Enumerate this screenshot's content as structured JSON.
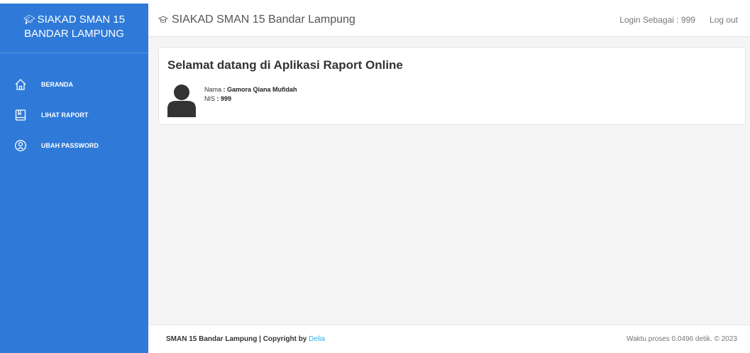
{
  "sidebar": {
    "brand_line1": "SIAKAD SMAN 15",
    "brand_line2": "BANDAR LAMPUNG",
    "items": [
      {
        "label": "BERANDA",
        "icon": "home-icon"
      },
      {
        "label": "LIHAT RAPORT",
        "icon": "book-icon"
      },
      {
        "label": "UBAH PASSWORD",
        "icon": "user-circle-icon"
      }
    ]
  },
  "header": {
    "title": "SIAKAD SMAN 15 Bandar Lampung",
    "login_info": "Login Sebagai : 999",
    "logout_label": "Log out"
  },
  "main": {
    "welcome": "Selamat datang di Aplikasi Raport Online",
    "nama_label": "Nama",
    "nama_value": ": Gamora Qiana Mufidah",
    "nis_label": "NIS",
    "nis_value": ": 999"
  },
  "footer": {
    "left_text": "SMAN 15 Bandar Lampung | Copyright by ",
    "author": "Delia",
    "right_text": "Waktu proses 0.0496 detik. © 2023"
  },
  "colors": {
    "sidebar": "#2f7ad8",
    "accent_link": "#2ab0e8"
  }
}
